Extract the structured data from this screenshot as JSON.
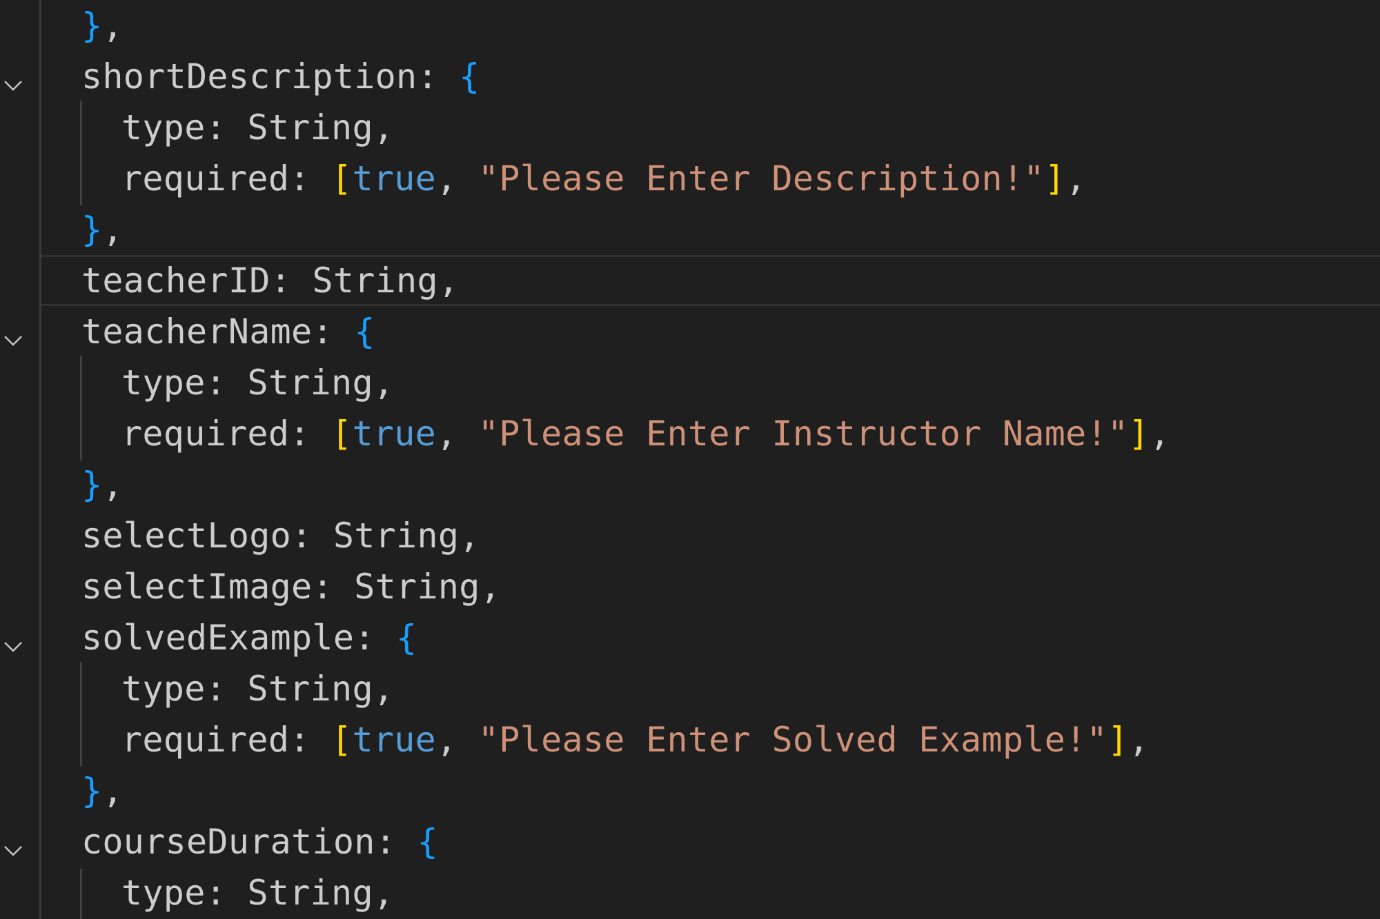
{
  "colors": {
    "background": "#1f1f1f",
    "text": "#cccccc",
    "brace": "#179fff",
    "bracket": "#ffd700",
    "keyword_true": "#569cd6",
    "string": "#ce9178"
  },
  "lines": {
    "l0": {
      "close": "}",
      "comma": ","
    },
    "l1": {
      "key": "shortDescription",
      "colon": ":",
      "open": "{"
    },
    "l2": {
      "key": "type",
      "colon": ":",
      "value": "String",
      "comma": ","
    },
    "l3": {
      "key": "required",
      "colon": ":",
      "open": "[",
      "bool": "true",
      "sep": ",",
      "message": "\"Please Enter Description!\"",
      "close": "]",
      "comma": ","
    },
    "l4": {
      "close": "}",
      "comma": ","
    },
    "l5": {
      "key": "teacherID",
      "colon": ":",
      "value": "String",
      "comma": ","
    },
    "l6": {
      "key": "teacherName",
      "colon": ":",
      "open": "{"
    },
    "l7": {
      "key": "type",
      "colon": ":",
      "value": "String",
      "comma": ","
    },
    "l8": {
      "key": "required",
      "colon": ":",
      "open": "[",
      "bool": "true",
      "sep": ",",
      "message": "\"Please Enter Instructor Name!\"",
      "close": "]",
      "comma": ","
    },
    "l9": {
      "close": "}",
      "comma": ","
    },
    "l10": {
      "key": "selectLogo",
      "colon": ":",
      "value": "String",
      "comma": ","
    },
    "l11": {
      "key": "selectImage",
      "colon": ":",
      "value": "String",
      "comma": ","
    },
    "l12": {
      "key": "solvedExample",
      "colon": ":",
      "open": "{"
    },
    "l13": {
      "key": "type",
      "colon": ":",
      "value": "String",
      "comma": ","
    },
    "l14": {
      "key": "required",
      "colon": ":",
      "open": "[",
      "bool": "true",
      "sep": ",",
      "message": "\"Please Enter Solved Example!\"",
      "close": "]",
      "comma": ","
    },
    "l15": {
      "close": "}",
      "comma": ","
    },
    "l16": {
      "key": "courseDuration",
      "colon": ":",
      "open": "{"
    },
    "l17": {
      "key": "type",
      "colon": ":",
      "value": "String",
      "comma": ","
    }
  },
  "icons": {
    "fold": "chevron-down-icon"
  }
}
